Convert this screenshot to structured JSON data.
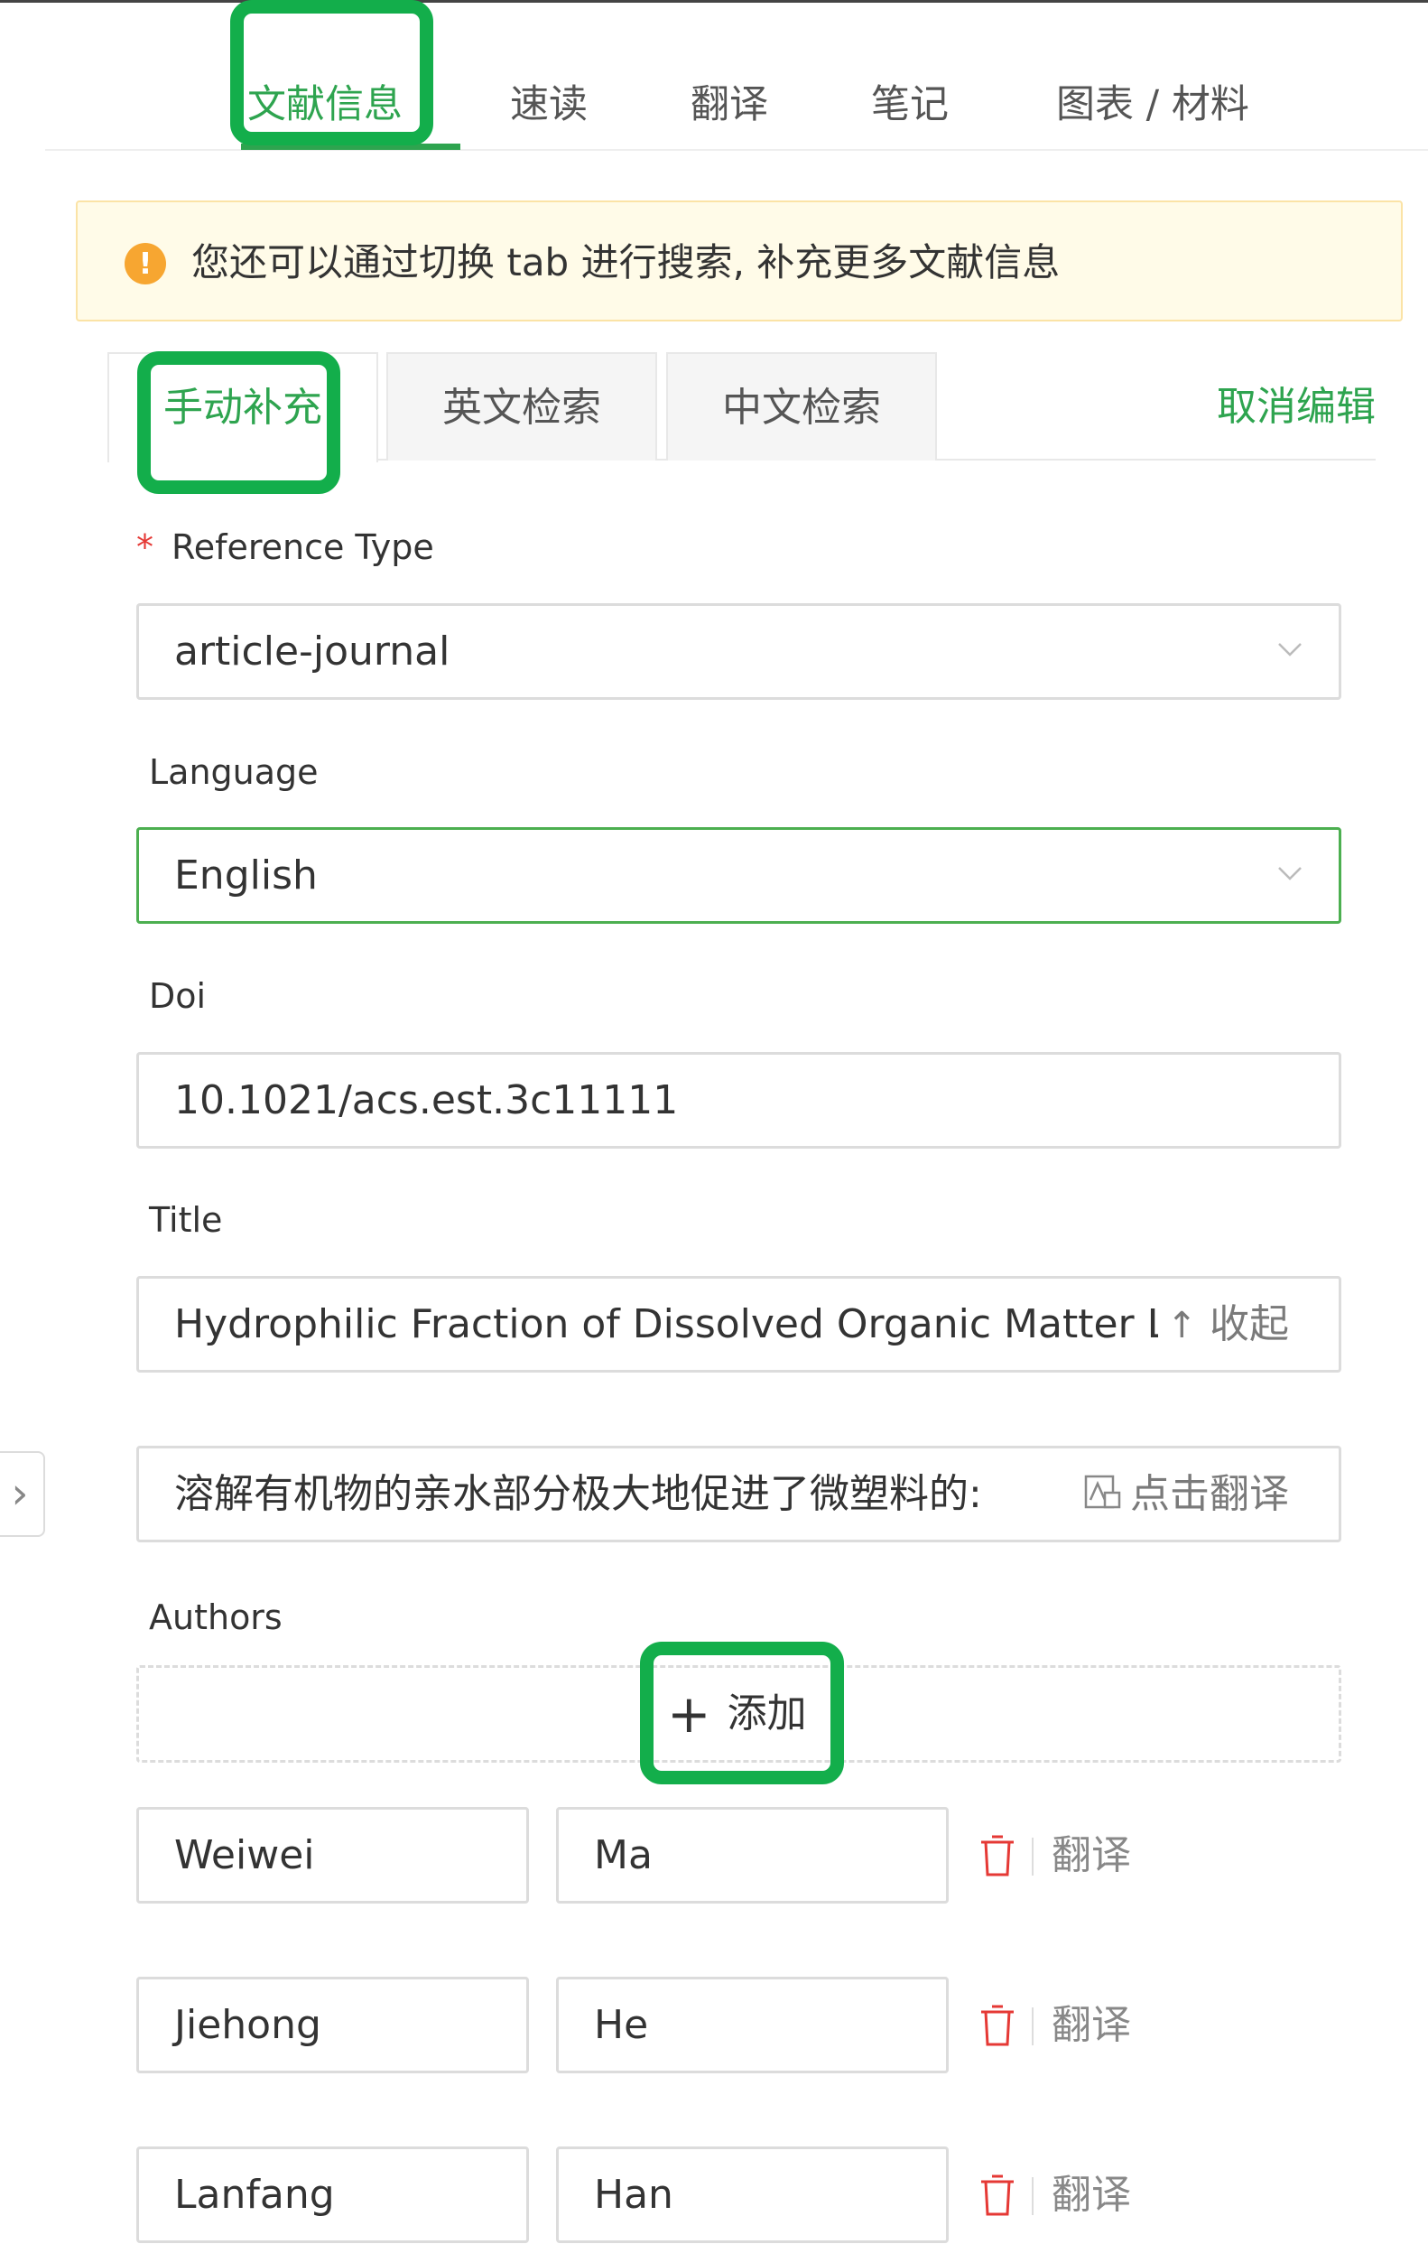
{
  "main_tabs": [
    {
      "label": "文献信息",
      "active": true
    },
    {
      "label": "速读",
      "active": false
    },
    {
      "label": "翻译",
      "active": false
    },
    {
      "label": "笔记",
      "active": false
    },
    {
      "label": "图表 / 材料",
      "active": false
    }
  ],
  "alert": {
    "icon": "warning-icon",
    "text": "您还可以通过切换 tab 进行搜索, 补充更多文献信息"
  },
  "sub_tabs": [
    {
      "label": "手动补充",
      "active": true
    },
    {
      "label": "英文检索",
      "active": false
    },
    {
      "label": "中文检索",
      "active": false
    }
  ],
  "cancel_edit": "取消编辑",
  "form": {
    "reference_type": {
      "required_mark": "*",
      "label": "Reference Type",
      "value": "article-journal"
    },
    "language": {
      "label": "Language",
      "value": "English"
    },
    "doi": {
      "label": "Doi",
      "value": "10.1021/acs.est.3c11111"
    },
    "title": {
      "label": "Title",
      "value": "Hydrophilic Fraction of Dissolved Organic Matter L",
      "collapse_label": "收起"
    },
    "title_translation": {
      "value": "溶解有机物的亲水部分极大地促进了微塑料的:",
      "translate_label": "点击翻译"
    },
    "authors": {
      "label": "Authors",
      "add_label": "添加",
      "list": [
        {
          "given": "Weiwei",
          "family": "Ma",
          "translate_label": "翻译"
        },
        {
          "given": "Jiehong",
          "family": "He",
          "translate_label": "翻译"
        },
        {
          "given": "Lanfang",
          "family": "Han",
          "translate_label": "翻译"
        }
      ]
    }
  },
  "colors": {
    "accent": "#2ea44f",
    "highlight": "#13ae4b",
    "warning": "#f7a631",
    "danger": "#e53935"
  }
}
